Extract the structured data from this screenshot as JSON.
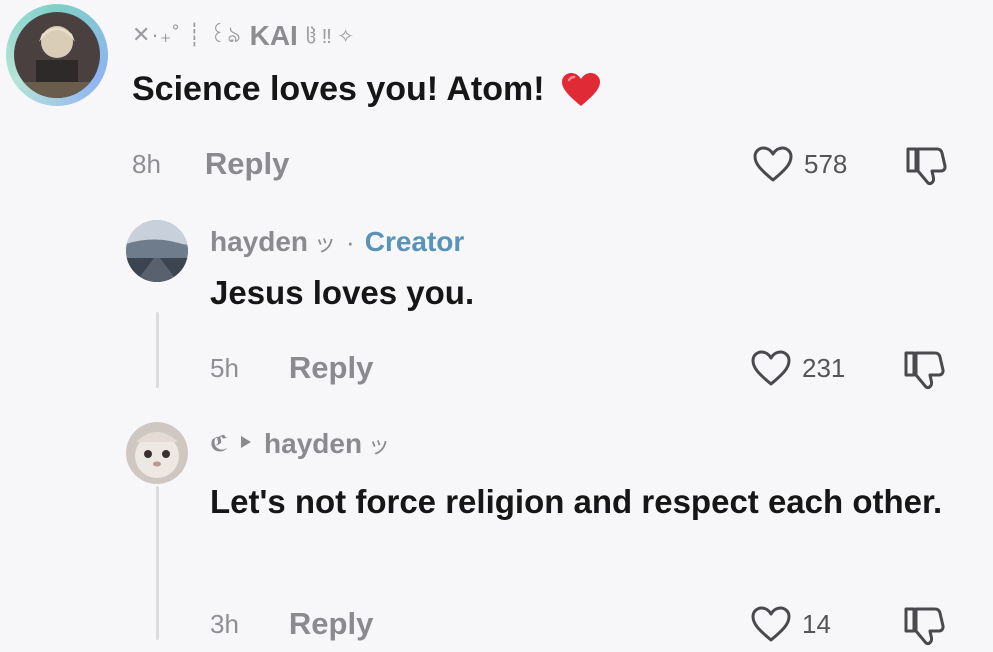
{
  "comments": [
    {
      "author": "KAI",
      "author_prefix": "✕·₊˚ ┊ ꒰ঌ",
      "author_suffix": "ჱ ‼ ✧",
      "text": "Science loves you! Atom!",
      "emoji": "❤️",
      "time": "8h",
      "reply_label": "Reply",
      "likes": "578"
    },
    {
      "author": "hayden",
      "author_suffix": "ッ",
      "separator": "·",
      "badge": "Creator",
      "text": "Jesus loves you.",
      "time": "5h",
      "reply_label": "Reply",
      "likes": "231"
    },
    {
      "author_prefix": "ℭ",
      "reply_to": "hayden",
      "reply_to_suffix": "ッ",
      "text": "Let's not force religion and respect each other.",
      "time": "3h",
      "reply_label": "Reply",
      "likes": "14"
    }
  ],
  "colors": {
    "background": "#f7f6f8",
    "creator_badge": "#5a93b8",
    "muted": "#8a8a8f",
    "story_ring_start": "#7fd0c8",
    "story_ring_end": "#8fb3f2"
  },
  "icons": {
    "like": "heart-outline-icon",
    "dislike": "thumbs-down-icon",
    "reply_arrow": "play-arrow-icon"
  }
}
